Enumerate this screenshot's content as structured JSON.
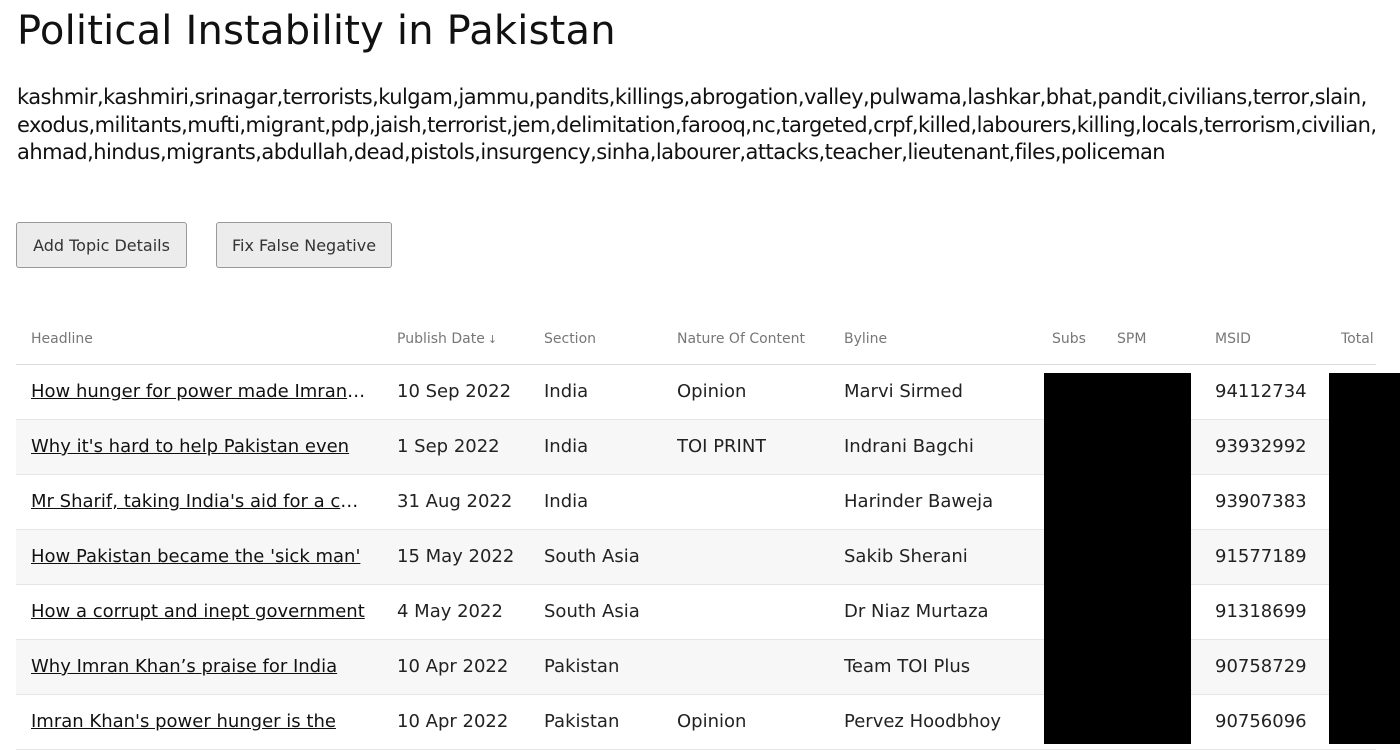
{
  "page": {
    "title": "Political Instability in Pakistan",
    "keywords": "kashmir,kashmiri,srinagar,terrorists,kulgam,jammu,pandits,killings,abrogation,valley,pulwama,lashkar,bhat,pandit,civilians,terror,slain,exodus,militants,mufti,migrant,pdp,jaish,terrorist,jem,delimitation,farooq,nc,targeted,crpf,killed,labourers,killing,locals,terrorism,civilian,ahmad,hindus,migrants,abdullah,dead,pistols,insurgency,sinha,labourer,attacks,teacher,lieutenant,files,policeman"
  },
  "buttons": {
    "add_topic": "Add Topic Details",
    "fix_false_negative": "Fix False Negative"
  },
  "table": {
    "headers": {
      "headline": "Headline",
      "publish_date": "Publish Date",
      "sort_indicator": "↓",
      "section": "Section",
      "nature": "Nature Of Content",
      "byline": "Byline",
      "subs": "Subs",
      "spm": "SPM",
      "msid": "MSID",
      "total": "Total"
    },
    "rows": [
      {
        "headline": "How hunger for power made Imran Khan",
        "date": "10 Sep 2022",
        "section": "India",
        "nature": "Opinion",
        "byline": "Marvi Sirmed",
        "msid": "94112734"
      },
      {
        "headline": "Why it's hard to help Pakistan even",
        "date": "1 Sep 2022",
        "section": "India",
        "nature": "TOI PRINT",
        "byline": "Indrani Bagchi",
        "msid": "93932992"
      },
      {
        "headline": "Mr Sharif, taking India's aid for a change",
        "date": "31 Aug 2022",
        "section": "India",
        "nature": "",
        "byline": "Harinder Baweja",
        "msid": "93907383"
      },
      {
        "headline": "How Pakistan became the 'sick man'",
        "date": "15 May 2022",
        "section": "South Asia",
        "nature": "",
        "byline": "Sakib Sherani",
        "msid": "91577189"
      },
      {
        "headline": "How a corrupt and inept government",
        "date": "4 May 2022",
        "section": "South Asia",
        "nature": "",
        "byline": "Dr Niaz Murtaza",
        "msid": "91318699"
      },
      {
        "headline": "Why Imran Khan’s praise for India",
        "date": "10 Apr 2022",
        "section": "Pakistan",
        "nature": "",
        "byline": "Team TOI Plus",
        "msid": "90758729"
      },
      {
        "headline": "Imran Khan's power hunger is the",
        "date": "10 Apr 2022",
        "section": "Pakistan",
        "nature": "Opinion",
        "byline": "Pervez Hoodbhoy",
        "msid": "90756096"
      }
    ]
  },
  "colors": {
    "redaction": "#000000",
    "row_alt": "#f7f7f7",
    "button_bg": "#ececec"
  }
}
